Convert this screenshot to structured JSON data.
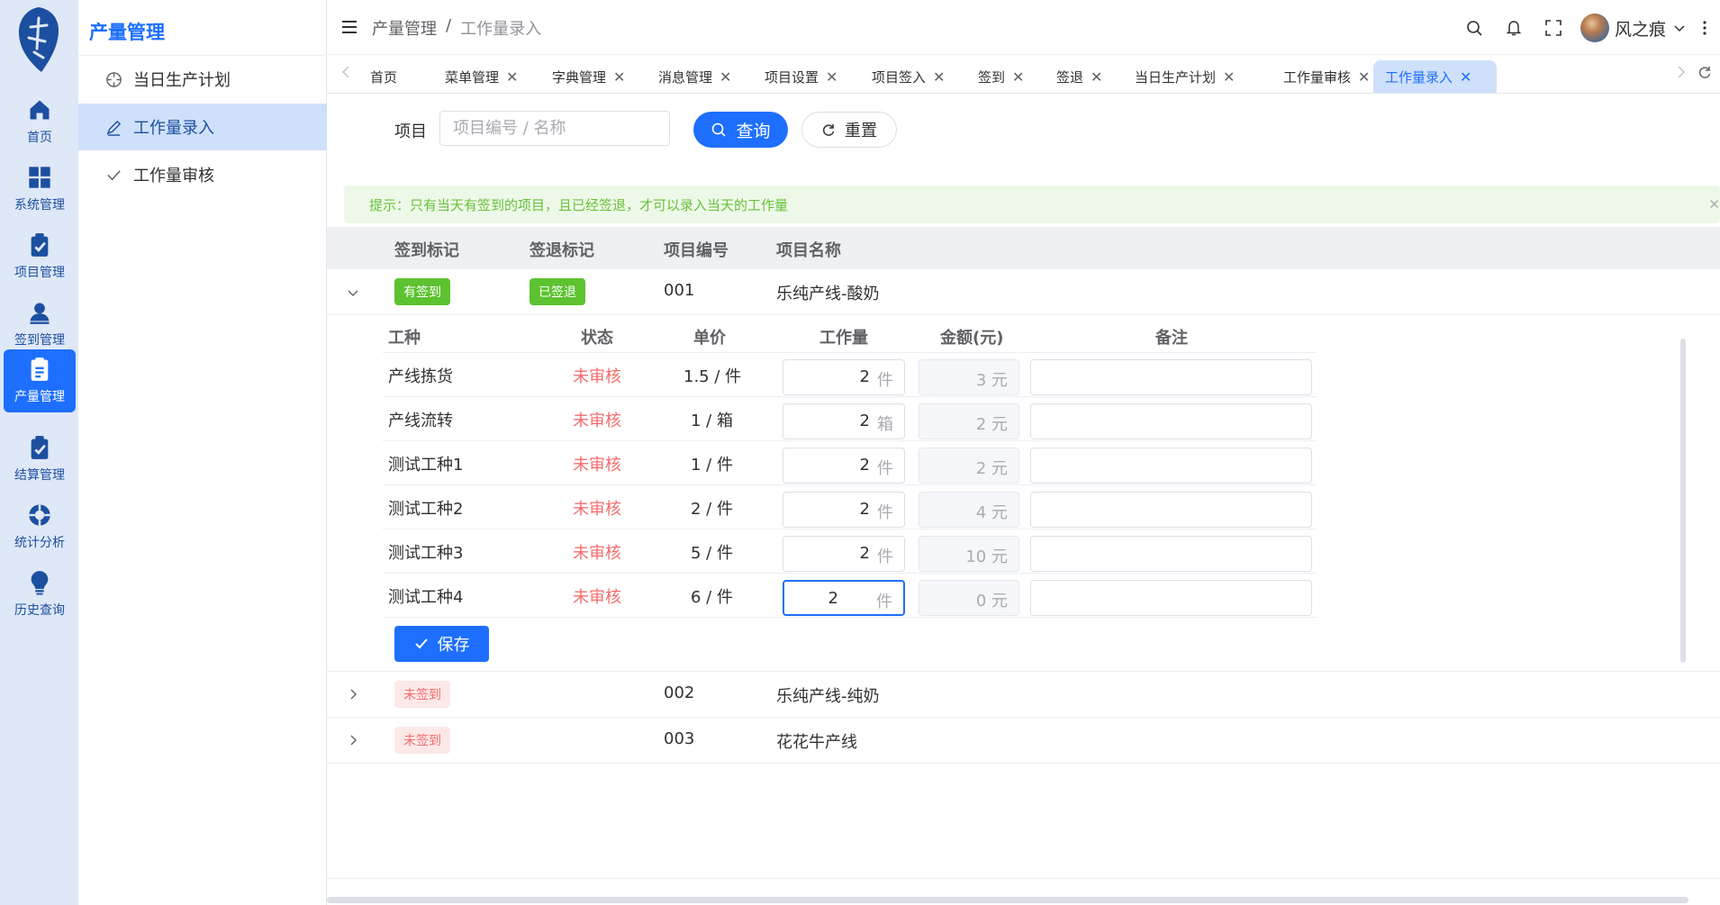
{
  "rail": {
    "items": [
      {
        "label": "首页",
        "icon": "home-icon"
      },
      {
        "label": "系统管理",
        "icon": "grid-icon"
      },
      {
        "label": "项目管理",
        "icon": "clipboard-check-icon"
      },
      {
        "label": "签到管理",
        "icon": "user-icon"
      },
      {
        "label": "产量管理",
        "icon": "document-icon",
        "active": true
      },
      {
        "label": "结算管理",
        "icon": "clipboard-check-icon"
      },
      {
        "label": "统计分析",
        "icon": "lifebuoy-icon"
      },
      {
        "label": "历史查询",
        "icon": "lightbulb-icon"
      }
    ]
  },
  "submenu": {
    "title": "产量管理",
    "items": [
      {
        "label": "当日生产计划",
        "icon": "crosshair-icon"
      },
      {
        "label": "工作量录入",
        "icon": "edit-icon",
        "active": true
      },
      {
        "label": "工作量审核",
        "icon": "check-icon"
      }
    ]
  },
  "header": {
    "breadcrumb": [
      "产量管理",
      "工作量录入"
    ],
    "separator": "/",
    "username": "风之痕"
  },
  "tabs": [
    {
      "label": "首页",
      "closable": false
    },
    {
      "label": "菜单管理",
      "closable": true
    },
    {
      "label": "字典管理",
      "closable": true
    },
    {
      "label": "消息管理",
      "closable": true
    },
    {
      "label": "项目设置",
      "closable": true
    },
    {
      "label": "项目签入",
      "closable": true
    },
    {
      "label": "签到",
      "closable": true
    },
    {
      "label": "签退",
      "closable": true
    },
    {
      "label": "当日生产计划",
      "closable": true
    },
    {
      "label": "工作量审核",
      "closable": true
    },
    {
      "label": "工作量录入",
      "closable": true,
      "active": true
    }
  ],
  "filter": {
    "label": "项目",
    "placeholder": "项目编号 / 名称",
    "query_label": "查询",
    "reset_label": "重置"
  },
  "alert": {
    "text": "提示：只有当天有签到的项目，且已经签退，才可以录入当天的工作量"
  },
  "table": {
    "headers": [
      "签到标记",
      "签退标记",
      "项目编号",
      "项目名称"
    ],
    "rows": [
      {
        "checkin": "有签到",
        "checkout": "已签退",
        "code": "001",
        "name": "乐纯产线-酸奶",
        "expanded": true
      },
      {
        "checkin": "未签到",
        "checkout": "",
        "code": "002",
        "name": "乐纯产线-纯奶",
        "expanded": false
      },
      {
        "checkin": "未签到",
        "checkout": "",
        "code": "003",
        "name": "花花牛产线",
        "expanded": false
      }
    ]
  },
  "detail": {
    "headers": [
      "工种",
      "状态",
      "单价",
      "工作量",
      "金额(元)",
      "备注"
    ],
    "rows": [
      {
        "type": "产线拣货",
        "status": "未审核",
        "price": "1.5 / 件",
        "qty": "2",
        "unit": "件",
        "amount": "3",
        "currency": "元",
        "note": ""
      },
      {
        "type": "产线流转",
        "status": "未审核",
        "price": "1 / 箱",
        "qty": "2",
        "unit": "箱",
        "amount": "2",
        "currency": "元",
        "note": ""
      },
      {
        "type": "测试工种1",
        "status": "未审核",
        "price": "1 / 件",
        "qty": "2",
        "unit": "件",
        "amount": "2",
        "currency": "元",
        "note": ""
      },
      {
        "type": "测试工种2",
        "status": "未审核",
        "price": "2 / 件",
        "qty": "2",
        "unit": "件",
        "amount": "4",
        "currency": "元",
        "note": ""
      },
      {
        "type": "测试工种3",
        "status": "未审核",
        "price": "5 / 件",
        "qty": "2",
        "unit": "件",
        "amount": "10",
        "currency": "元",
        "note": ""
      },
      {
        "type": "测试工种4",
        "status": "未审核",
        "price": "6 / 件",
        "qty": "2",
        "unit": "件",
        "amount": "0",
        "currency": "元",
        "note": "",
        "focused": true
      }
    ],
    "save_label": "保存"
  }
}
